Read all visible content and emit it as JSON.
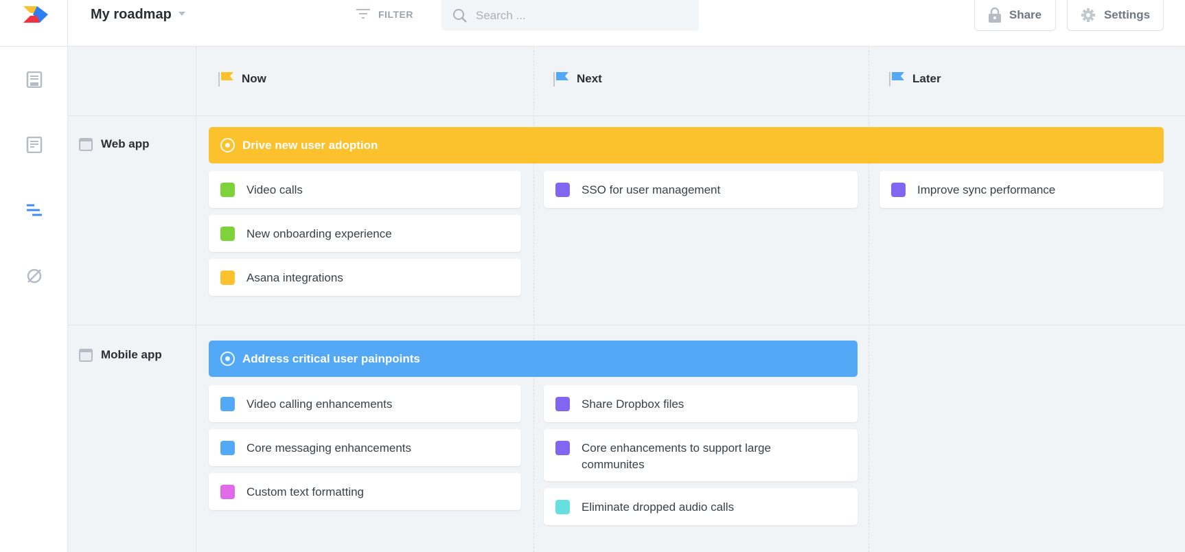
{
  "header": {
    "title": "My roadmap",
    "filter_label": "FILTER",
    "search_placeholder": "Search ...",
    "share_label": "Share",
    "settings_label": "Settings"
  },
  "sidebar": {
    "icons": [
      "roadmap-doc-icon",
      "notes-icon",
      "timeline-icon",
      "hidden-icon"
    ],
    "active_index": 2
  },
  "columns": [
    {
      "label": "Now",
      "flag_color": "#fcc22e"
    },
    {
      "label": "Next",
      "flag_color": "#54a9f7"
    },
    {
      "label": "Later",
      "flag_color": "#54a9f7"
    }
  ],
  "lanes": [
    {
      "label": "Web app",
      "objective": {
        "label": "Drive new user adoption",
        "color": "#fcc22e"
      },
      "now": [
        {
          "label": "Video calls",
          "color": "#7ed23a"
        },
        {
          "label": "New onboarding experience",
          "color": "#7ed23a"
        },
        {
          "label": "Asana integrations",
          "color": "#fcc22e"
        }
      ],
      "next": [
        {
          "label": "SSO for user management",
          "color": "#8066f0"
        }
      ],
      "later": [
        {
          "label": "Improve sync performance",
          "color": "#8066f0"
        }
      ]
    },
    {
      "label": "Mobile app",
      "objective": {
        "label": "Address critical user painpoints",
        "color": "#54a9f7"
      },
      "now": [
        {
          "label": "Video calling enhancements",
          "color": "#54a9f7"
        },
        {
          "label": "Core messaging enhancements",
          "color": "#54a9f7"
        },
        {
          "label": "Custom text formatting",
          "color": "#e06ae8"
        }
      ],
      "next": [
        {
          "label": "Share Dropbox files",
          "color": "#8066f0"
        },
        {
          "label": "Core enhancements to support large communites",
          "color": "#8066f0"
        },
        {
          "label": "Eliminate dropped audio calls",
          "color": "#67dfdf"
        }
      ],
      "later": []
    }
  ]
}
